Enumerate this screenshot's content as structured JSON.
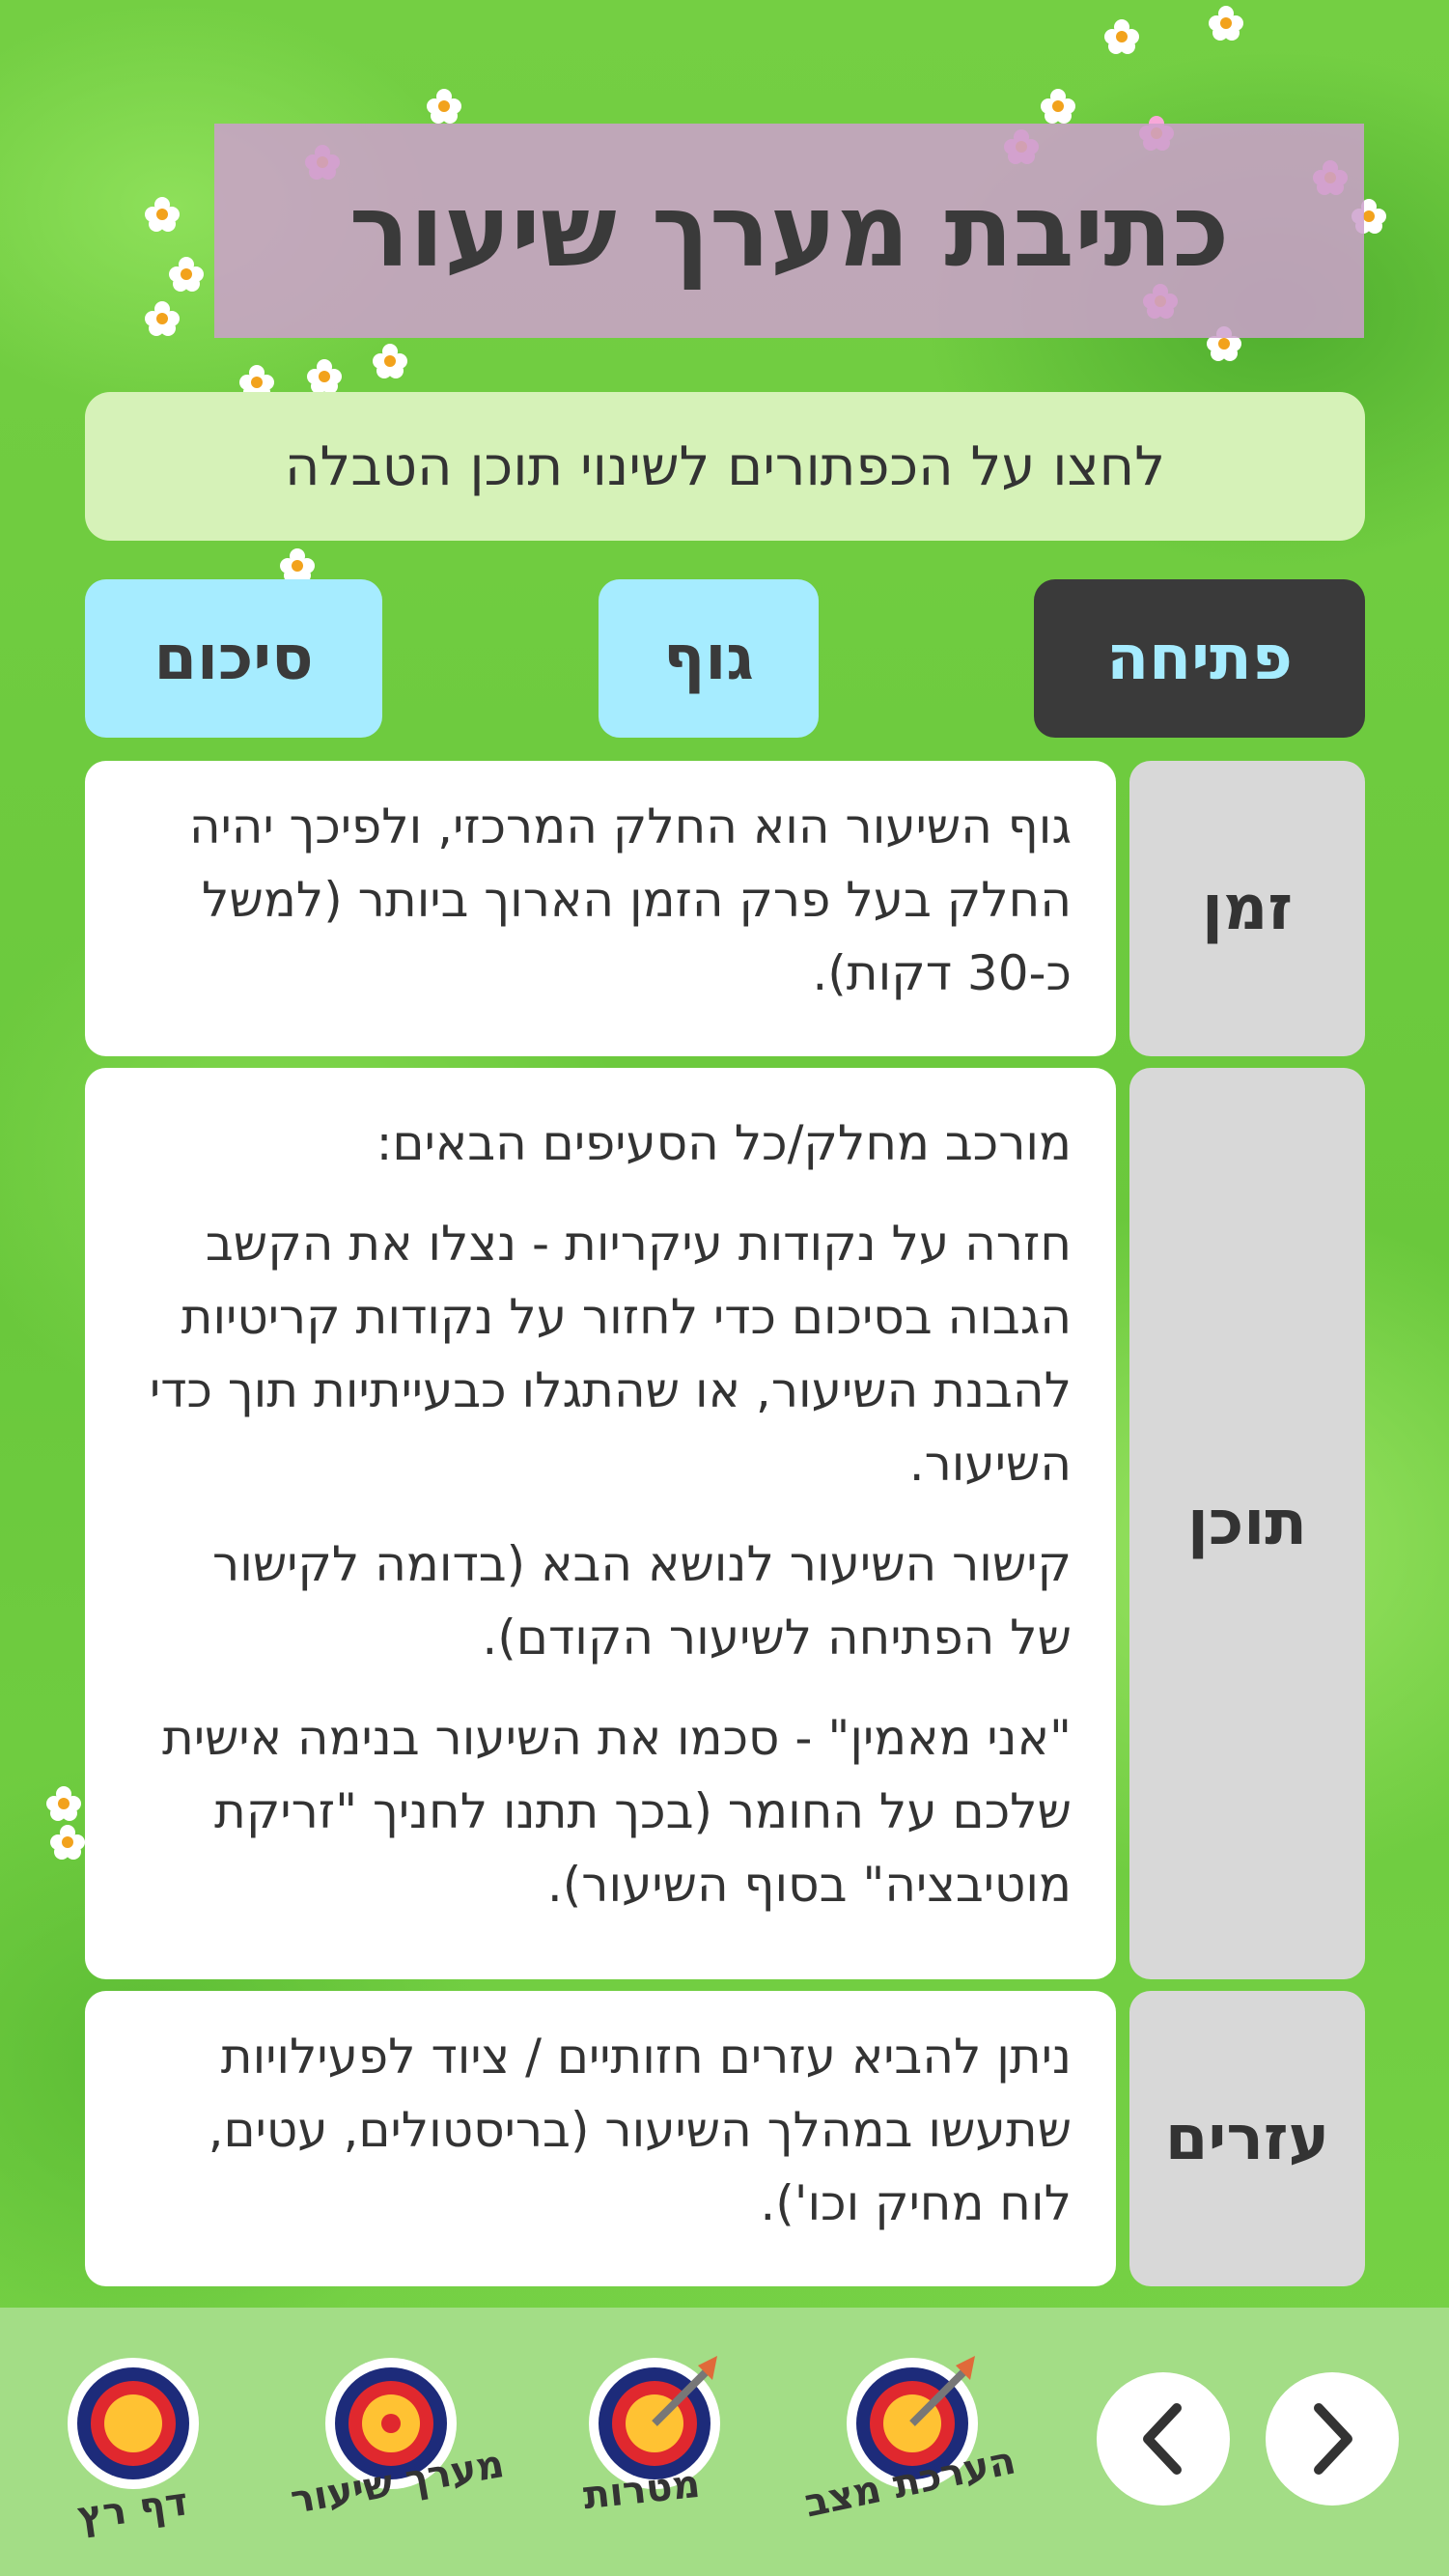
{
  "page": {
    "title": "כתיבת מערך שיעור",
    "instructions": "לחצו על הכפתורים לשינוי תוכן הטבלה"
  },
  "tabs": [
    {
      "label": "פתיחה",
      "active": true
    },
    {
      "label": "גוף",
      "active": false
    },
    {
      "label": "סיכום",
      "active": false
    }
  ],
  "table": {
    "time": {
      "label": "זמן",
      "text": "גוף השיעור הוא החלק המרכזי, ולפיכך יהיה החלק בעל פרק הזמן הארוך ביותר (למשל כ-30 דקות)."
    },
    "content": {
      "label": "תוכן",
      "paragraphs": [
        "מורכב מחלק/כל הסעיפים הבאים:",
        "חזרה על נקודות עיקריות - נצלו את הקשב הגבוה בסיכום כדי לחזור על נקודות קריטיות להבנת השיעור, או שהתגלו כבעייתיות תוך כדי השיעור.",
        "קישור השיעור לנושא הבא (בדומה לקישור של הפתיחה לשיעור הקודם).",
        "\"אני מאמין\" - סכמו את השיעור בנימה אישית שלכם על החומר (בכך תתנו לחניך \"זריקת מוטיבציה\" בסוף השיעור)."
      ]
    },
    "aids": {
      "label": "עזרים",
      "text": "ניתן להביא עזרים חזותיים / ציוד לפעילויות שתעשו במהלך השיעור (בריסטולים, עטים, לוח מחיק וכו')."
    }
  },
  "bottom_nav": {
    "items": [
      {
        "label": "הערכת מצב",
        "icon": "target-with-arrow-icon"
      },
      {
        "label": "מטרות",
        "icon": "target-with-arrow-icon"
      },
      {
        "label": "מערך שיעור",
        "icon": "target-icon"
      },
      {
        "label": "דף רץ",
        "icon": "target-icon"
      }
    ],
    "next_icon": "chevron-right-icon",
    "prev_icon": "chevron-left-icon"
  },
  "colors": {
    "title_bg": "#cda0cd",
    "tab_active_bg": "#3a3a3a",
    "tab_active_text": "#a6ecff",
    "tab_inactive_bg": "#a6ecff",
    "row_label_bg": "#d8d8d8",
    "bottom_bar_bg": "#a3dd86"
  }
}
